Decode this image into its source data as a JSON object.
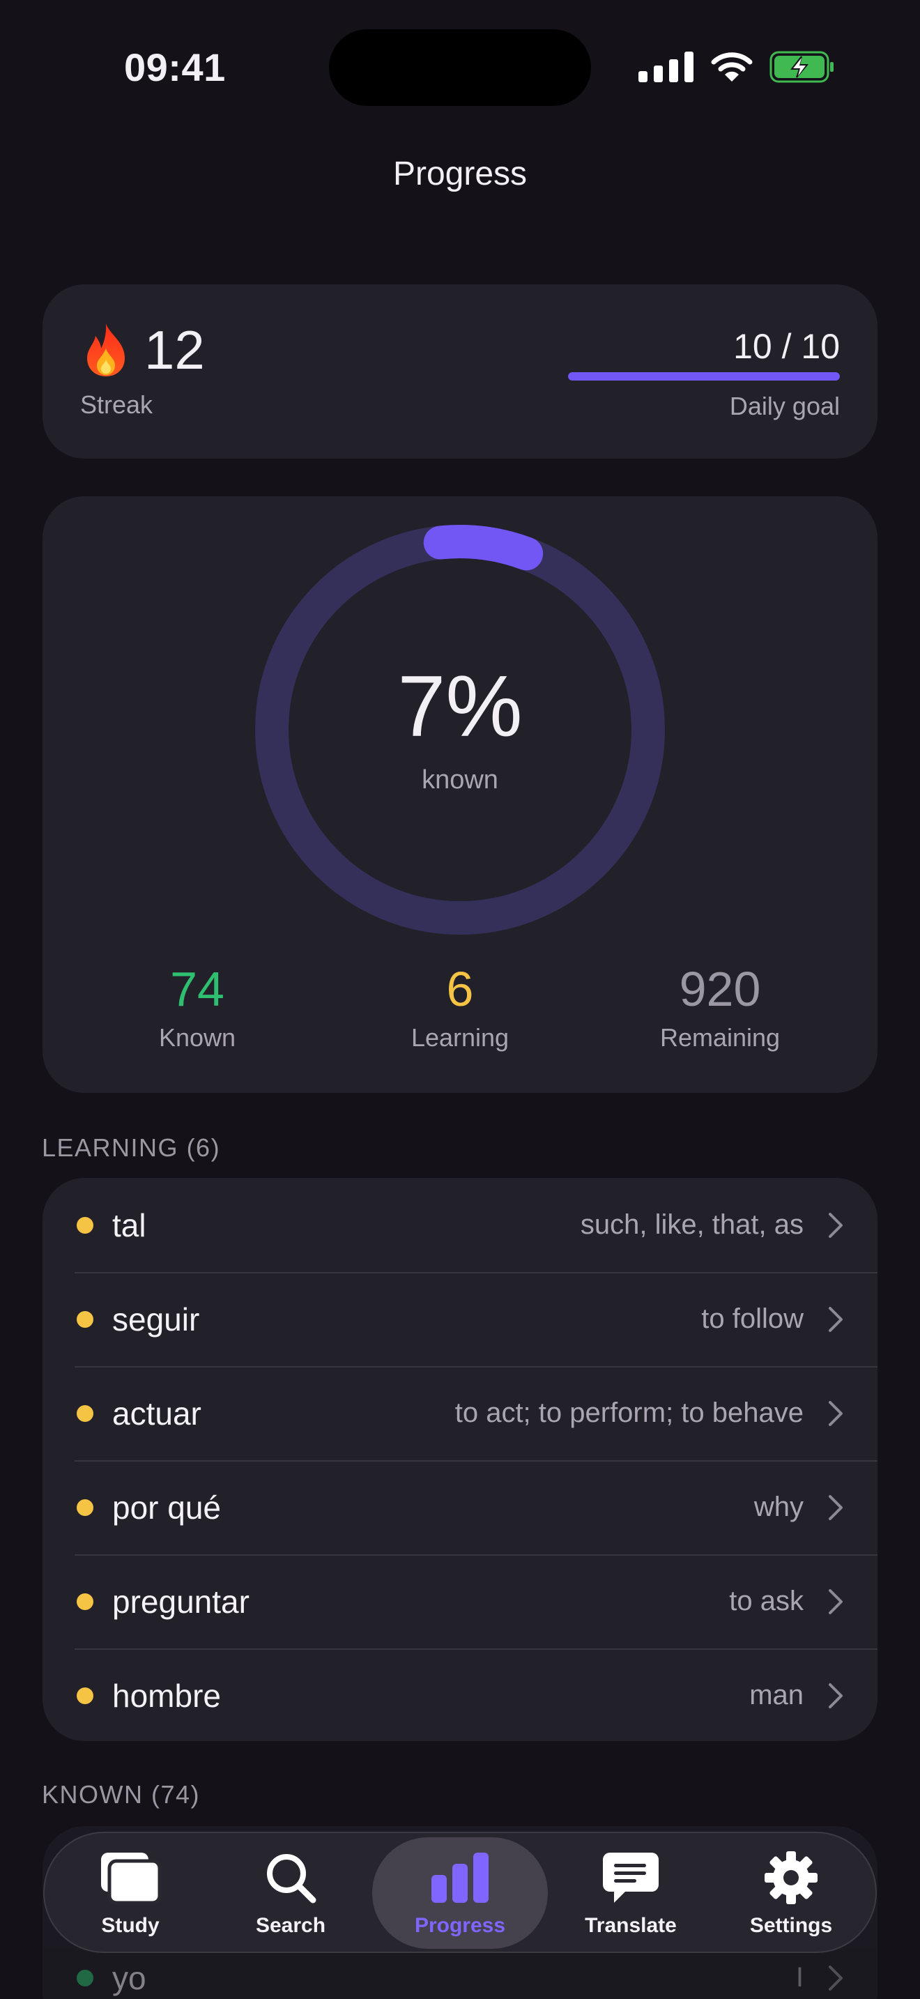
{
  "status_bar": {
    "time": "09:41"
  },
  "nav": {
    "title": "Progress"
  },
  "streak": {
    "count": "12",
    "label": "Streak"
  },
  "daily_goal": {
    "value": "10 / 10",
    "label": "Daily goal",
    "progress": 1.0
  },
  "ring": {
    "percent": "7%",
    "label": "known",
    "fraction": 0.074
  },
  "stats": [
    {
      "value": "74",
      "label": "Known",
      "color": "#2fbf71"
    },
    {
      "value": "6",
      "label": "Learning",
      "color": "#f6c445"
    },
    {
      "value": "920",
      "label": "Remaining",
      "color": "#9b98a3"
    }
  ],
  "learning": {
    "header": "LEARNING",
    "count": "(6)",
    "items": [
      {
        "word": "tal",
        "meaning": "such, like, that, as"
      },
      {
        "word": "seguir",
        "meaning": "to follow"
      },
      {
        "word": "actuar",
        "meaning": "to act; to perform; to behave"
      },
      {
        "word": "por qué",
        "meaning": "why"
      },
      {
        "word": "preguntar",
        "meaning": "to ask"
      },
      {
        "word": "hombre",
        "meaning": "man"
      }
    ]
  },
  "known": {
    "header": "KNOWN",
    "count": "(74)",
    "items": [
      {
        "word": "yo",
        "meaning": "I"
      }
    ]
  },
  "tabs": [
    {
      "label": "Study",
      "icon": "cards-icon"
    },
    {
      "label": "Search",
      "icon": "search-icon"
    },
    {
      "label": "Progress",
      "icon": "chart-icon",
      "active": true
    },
    {
      "label": "Translate",
      "icon": "chat-bubble-icon"
    },
    {
      "label": "Settings",
      "icon": "gear-icon"
    }
  ],
  "colors": {
    "accent": "#7357f5",
    "ring_track": "#35305a",
    "known": "#2fbf71",
    "learning": "#f6c445",
    "background": "#141218",
    "card": "#222029"
  }
}
